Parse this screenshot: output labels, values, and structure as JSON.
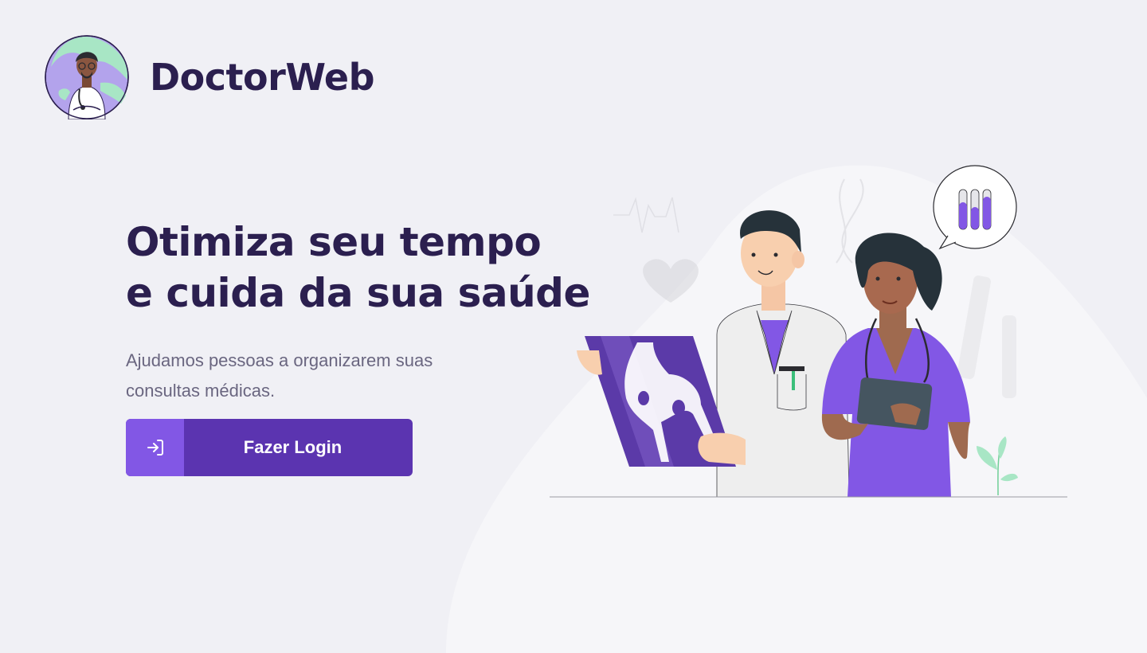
{
  "brand": {
    "name": "DoctorWeb",
    "logo_icon": "doctor-avatar-icon"
  },
  "hero": {
    "headline_line1": "Otimiza seu tempo",
    "headline_line2": "e cuida da sua saúde",
    "description": "Ajudamos pessoas a organizarem suas consultas médicas."
  },
  "login_button": {
    "label": "Fazer Login",
    "icon": "sign-in-icon"
  },
  "colors": {
    "background": "#f0f0f5",
    "heading": "#2b1f4f",
    "text": "#6a6680",
    "primary": "#5b34b0",
    "primary_light": "#8257e5"
  },
  "illustration": {
    "icon": "doctors-xray-illustration"
  }
}
